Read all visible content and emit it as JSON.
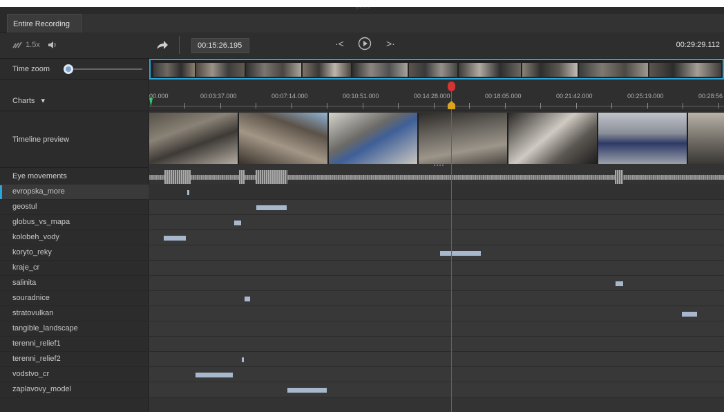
{
  "tab": {
    "label": "Entire Recording"
  },
  "controls": {
    "speed": "1.5x",
    "current_time": "00:15:26.195",
    "end_time": "00:29:29.112",
    "prev_symbol": "·<",
    "next_symbol": ">·"
  },
  "labels": {
    "time_zoom": "Time zoom",
    "charts": "Charts",
    "charts_caret": "▾",
    "timeline_preview": "Timeline preview",
    "eye_movements": "Eye movements"
  },
  "ruler_ticks": [
    "00.000",
    "00:03:37.000",
    "00:07:14.000",
    "00:10:51.000",
    "00:14:28.000",
    "00:18:05.000",
    "00:21:42.000",
    "00:25:19.000",
    "00:28:56"
  ],
  "rows": [
    {
      "name": "evropska_more"
    },
    {
      "name": "geostul"
    },
    {
      "name": "globus_vs_mapa"
    },
    {
      "name": "kolobeh_vody"
    },
    {
      "name": "koryto_reky"
    },
    {
      "name": "kraje_cr"
    },
    {
      "name": "salinita"
    },
    {
      "name": "souradnice"
    },
    {
      "name": "stratovulkan"
    },
    {
      "name": "tangible_landscape"
    },
    {
      "name": "terenni_relief1"
    },
    {
      "name": "terenni_relief2"
    },
    {
      "name": "vodstvo_cr"
    },
    {
      "name": "zaplavovy_model"
    }
  ],
  "colors": {
    "accent": "#2aa4d9",
    "playhead": "#d63333",
    "segment": "#a7b8cc",
    "marker_yellow": "#d9a520",
    "marker_green": "#3cc36b"
  }
}
